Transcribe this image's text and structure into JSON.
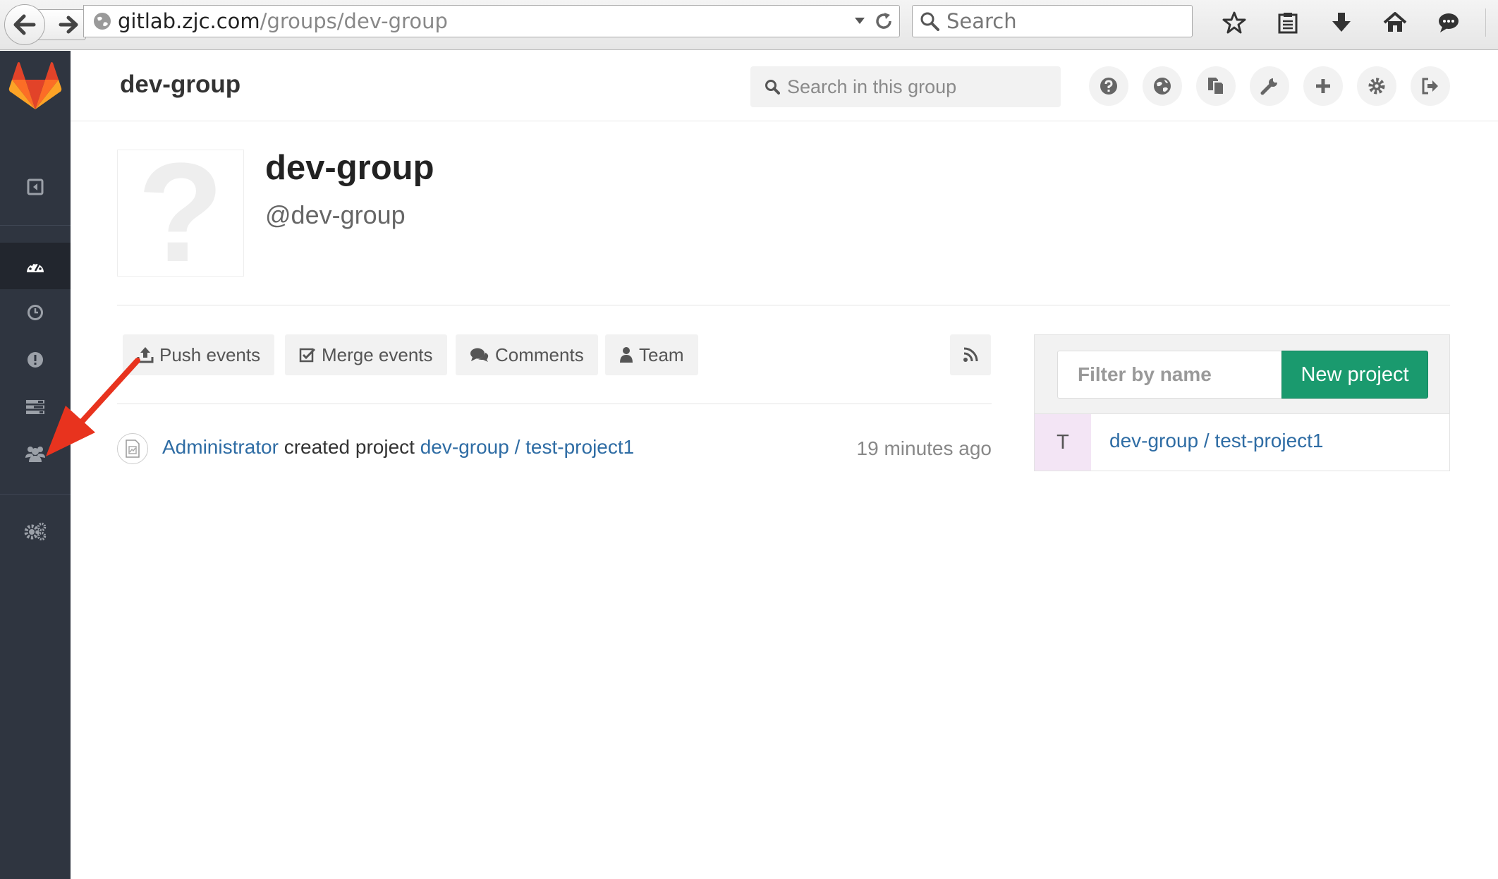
{
  "browser": {
    "url_host": "gitlab.zjc.com",
    "url_path": "/groups/dev-group",
    "search_placeholder": "Search"
  },
  "header": {
    "title": "dev-group",
    "search_placeholder": "Search in this group"
  },
  "group": {
    "name": "dev-group",
    "path": "@dev-group",
    "avatar_placeholder": "?"
  },
  "event_filters": {
    "push": "Push events",
    "merge": "Merge events",
    "comments": "Comments",
    "team": "Team"
  },
  "event": {
    "author": "Administrator",
    "action": " created project ",
    "project": "dev-group / test-project1",
    "time": "19 minutes ago"
  },
  "projects": {
    "filter_placeholder": "Filter by name",
    "new_button": "New project",
    "items": [
      {
        "initial": "T",
        "name": "dev-group / test-project1"
      }
    ]
  },
  "colors": {
    "sidebar": "#2f3540",
    "accent_green": "#1a9a6e",
    "link": "#2e6ca4",
    "arrow": "#e8331e"
  }
}
